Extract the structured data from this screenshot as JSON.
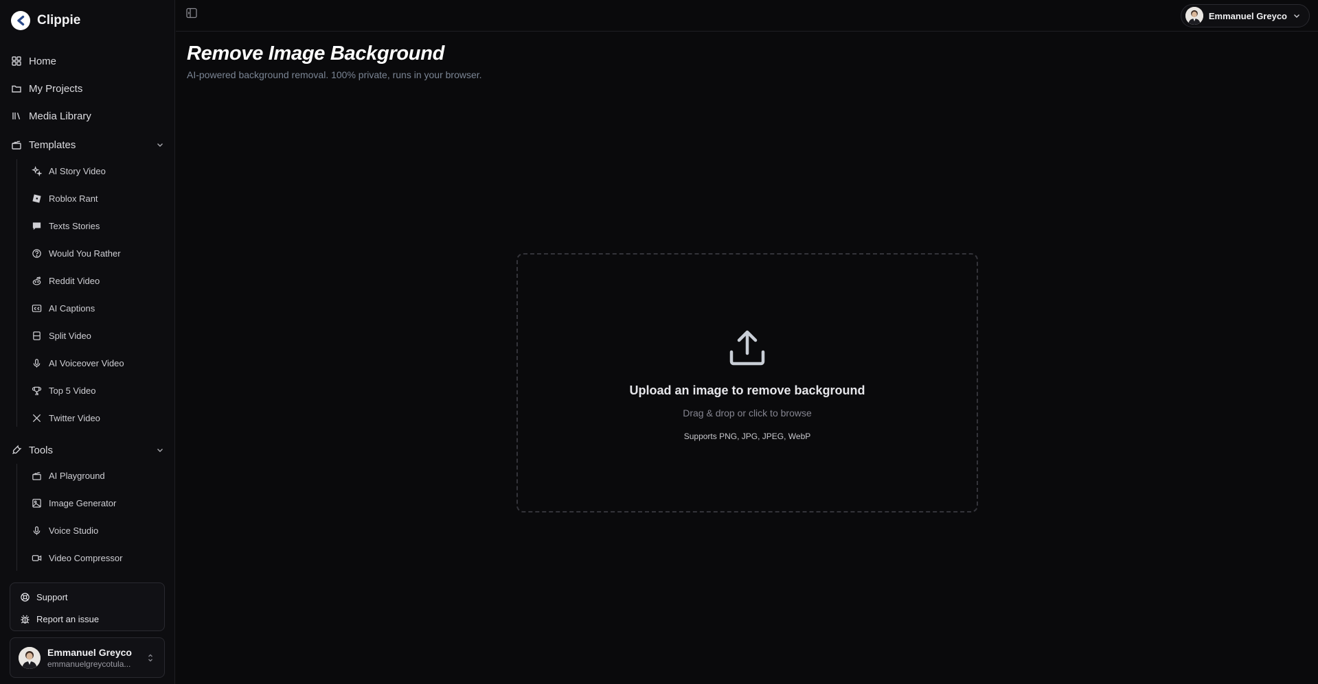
{
  "brand": {
    "name": "Clippie"
  },
  "nav": {
    "home": "Home",
    "projects": "My Projects",
    "media": "Media Library"
  },
  "templates": {
    "label": "Templates",
    "items": [
      "AI Story Video",
      "Roblox Rant",
      "Texts Stories",
      "Would You Rather",
      "Reddit Video",
      "AI Captions",
      "Split Video",
      "AI Voiceover Video",
      "Top 5 Video",
      "Twitter Video"
    ]
  },
  "tools": {
    "label": "Tools",
    "items": [
      "AI Playground",
      "Image Generator",
      "Voice Studio",
      "Video Compressor"
    ]
  },
  "help": {
    "support": "Support",
    "report": "Report an issue"
  },
  "user": {
    "name": "Emmanuel Greyco",
    "email": "emmanuelgreycotula..."
  },
  "header": {
    "account_name": "Emmanuel Greyco"
  },
  "main": {
    "title": "Remove Image Background",
    "subtitle": "AI-powered background removal. 100% private, runs in your browser.",
    "upload_title": "Upload an image to remove background",
    "upload_hint": "Drag & drop or click to browse",
    "upload_formats": "Supports PNG, JPG, JPEG, WebP"
  },
  "colors": {
    "background": "#0a0a0c",
    "sidebar": "#0d0d10",
    "subtitle": "#7b8594"
  }
}
